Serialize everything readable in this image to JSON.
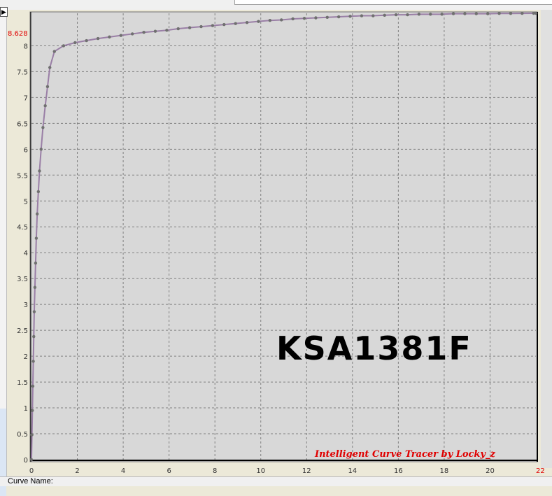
{
  "status": {
    "curve_name_label": "Curve Name:"
  },
  "topbar": {
    "arrow_glyph": "▶"
  },
  "chart_data": {
    "type": "line",
    "title": "KSA1381F",
    "credit": "Intelligent Curve Tracer by Locky_z",
    "xlim": [
      0,
      22
    ],
    "ylim": [
      0,
      8.628
    ],
    "x_ticks": [
      0,
      2,
      4,
      6,
      8,
      10,
      12,
      14,
      16,
      18,
      20,
      22
    ],
    "y_ticks": [
      0,
      0.5,
      1,
      1.5,
      2,
      2.5,
      3,
      3.5,
      4,
      4.5,
      5,
      5.5,
      6,
      6.5,
      7,
      7.5,
      8
    ],
    "x_max_label": "22",
    "y_max_label": "8.628",
    "grid": true,
    "colors": {
      "line": "#9a7fa6",
      "marker": "#707070",
      "plot_bg": "#d8d8d8",
      "grid": "#808080",
      "limit_labels": "#e00000"
    },
    "series": [
      {
        "x": [
          0,
          0.02,
          0.04,
          0.06,
          0.08,
          0.1,
          0.12,
          0.15,
          0.18,
          0.21,
          0.25,
          0.3,
          0.35,
          0.42,
          0.5,
          0.6,
          0.7,
          0.8,
          1.0,
          1.4,
          1.9,
          2.4,
          2.9,
          3.4,
          3.9,
          4.4,
          4.9,
          5.4,
          5.9,
          6.4,
          6.9,
          7.4,
          7.9,
          8.4,
          8.9,
          9.4,
          9.9,
          10.4,
          10.9,
          11.4,
          11.9,
          12.4,
          12.9,
          13.4,
          13.9,
          14.4,
          14.9,
          15.4,
          15.9,
          16.4,
          16.9,
          17.4,
          17.9,
          18.4,
          18.9,
          19.4,
          19.9,
          20.4,
          20.9,
          21.4,
          21.9,
          22.0
        ],
        "y": [
          0,
          0.48,
          0.95,
          1.42,
          1.9,
          2.38,
          2.86,
          3.33,
          3.8,
          4.28,
          4.75,
          5.18,
          5.58,
          6.0,
          6.42,
          6.84,
          7.21,
          7.58,
          7.89,
          8.0,
          8.06,
          8.1,
          8.14,
          8.17,
          8.2,
          8.23,
          8.26,
          8.28,
          8.3,
          8.33,
          8.35,
          8.37,
          8.39,
          8.41,
          8.43,
          8.45,
          8.47,
          8.49,
          8.5,
          8.52,
          8.53,
          8.54,
          8.55,
          8.56,
          8.57,
          8.58,
          8.58,
          8.59,
          8.6,
          8.6,
          8.61,
          8.61,
          8.61,
          8.62,
          8.62,
          8.62,
          8.62,
          8.625,
          8.625,
          8.627,
          8.628,
          8.628
        ]
      }
    ]
  }
}
